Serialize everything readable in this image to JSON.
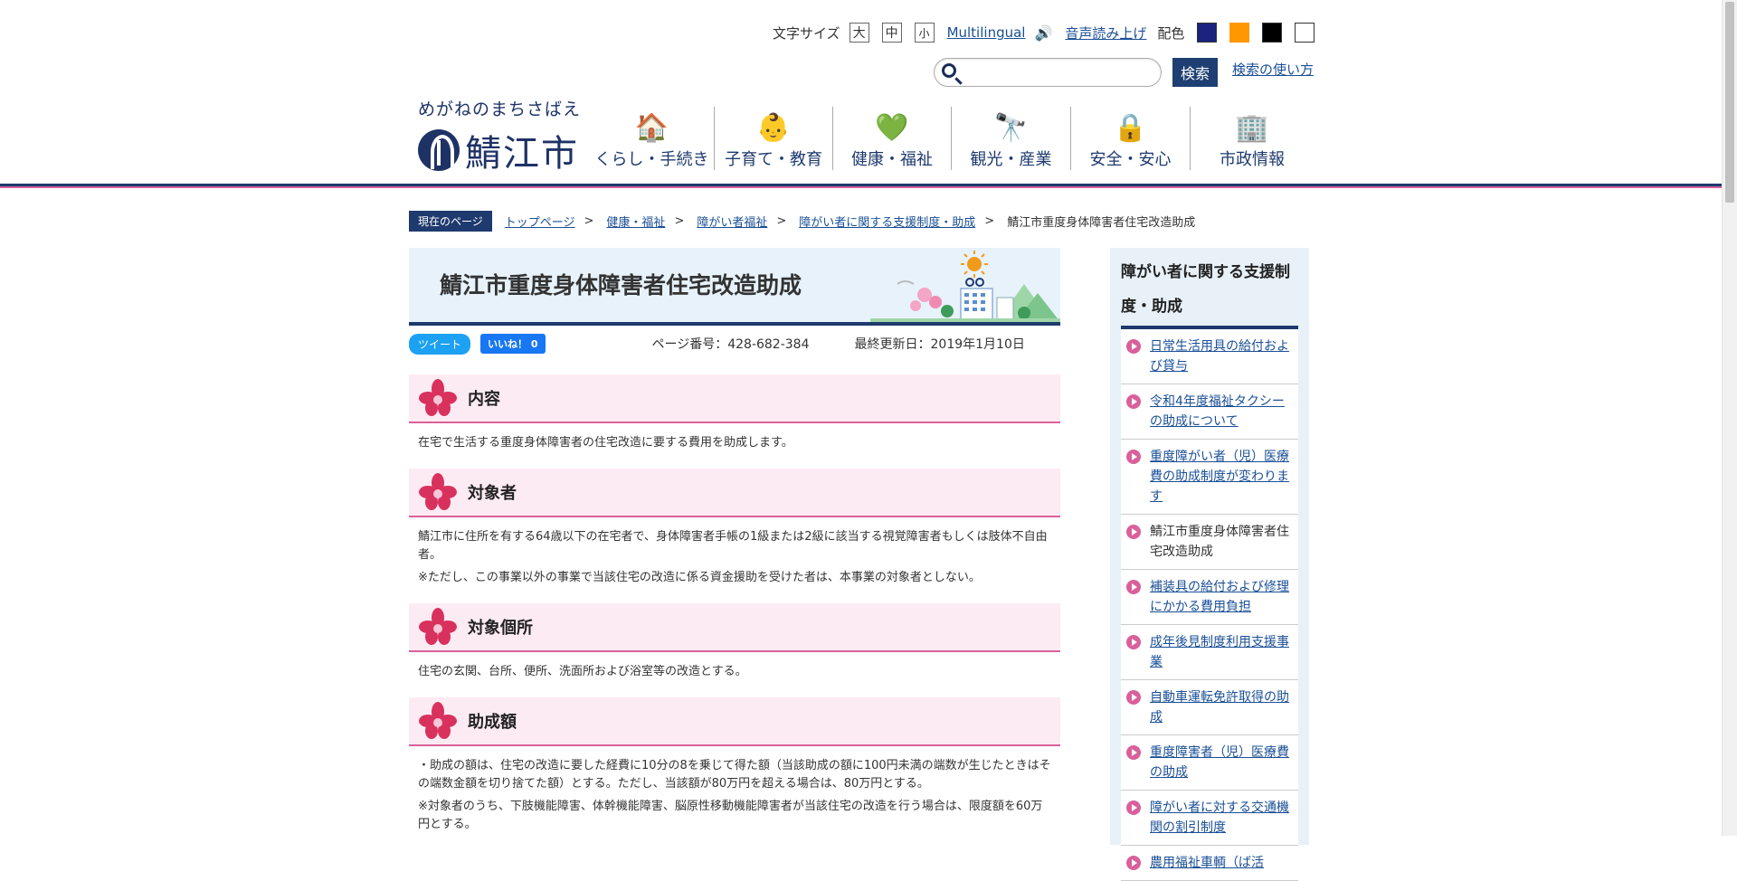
{
  "header": {
    "font_size_label": "文字サイズ",
    "font_sizes": [
      "大",
      "中",
      "小"
    ],
    "multilingual": "Multilingual",
    "read_aloud": "音声読み上げ",
    "color_label": "配色",
    "color_swatches": [
      "#1a237e",
      "#ff9800",
      "#000000",
      "#ffffff"
    ],
    "search_placeholder": "",
    "search_button": "検索",
    "search_help": "検索の使い方",
    "logo_kana": "めがねのまちさばえ",
    "logo_name": "鯖江市"
  },
  "gnav": [
    {
      "label": "くらし・手続き",
      "icon": "house-icon"
    },
    {
      "label": "子育て・教育",
      "icon": "baby-icon"
    },
    {
      "label": "健康・福祉",
      "icon": "heart-icon"
    },
    {
      "label": "観光・産業",
      "icon": "binoculars-icon"
    },
    {
      "label": "安全・安心",
      "icon": "lock-icon"
    },
    {
      "label": "市政情報",
      "icon": "building-icon"
    }
  ],
  "breadcrumb": {
    "here": "現在のページ",
    "items": [
      "トップページ",
      "健康・福祉",
      "障がい者福祉",
      "障がい者に関する支援制度・助成"
    ],
    "current": "鯖江市重度身体障害者住宅改造助成"
  },
  "main": {
    "title": "鯖江市重度身体障害者住宅改造助成",
    "tweet": "ツイート",
    "like": "いいね！ 0",
    "page_no": "ページ番号：428-682-384",
    "updated": "最終更新日：2019年1月10日",
    "sections": [
      {
        "heading": "内容",
        "paras": [
          "在宅で生活する重度身体障害者の住宅改造に要する費用を助成します。"
        ]
      },
      {
        "heading": "対象者",
        "paras": [
          "鯖江市に住所を有する64歳以下の在宅者で、身体障害者手帳の1級または2級に該当する視覚障害者もしくは肢体不自由者。",
          "※ただし、この事業以外の事業で当該住宅の改造に係る資金援助を受けた者は、本事業の対象者としない。"
        ]
      },
      {
        "heading": "対象個所",
        "paras": [
          "住宅の玄関、台所、便所、洗面所および浴室等の改造とする。"
        ]
      },
      {
        "heading": "助成額",
        "paras": [
          "・助成の額は、住宅の改造に要した経費に10分の8を乗じて得た額（当該助成の額に100円未満の端数が生じたときはその端数金額を切り捨てた額）とする。ただし、当該額が80万円を超える場合は、80万円とする。",
          "※対象者のうち、下肢機能障害、体幹機能障害、脳原性移動機能障害者が当該住宅の改造を行う場合は、限度額を60万円とする。"
        ]
      }
    ]
  },
  "side": {
    "title": "障がい者に関する支援制度・助成",
    "items": [
      {
        "label": "日常生活用具の給付および貸与",
        "link": true
      },
      {
        "label": "令和4年度福祉タクシーの助成について",
        "link": true
      },
      {
        "label": "重度障がい者（児）医療費の助成制度が変わります",
        "link": true
      },
      {
        "label": "鯖江市重度身体障害者住宅改造助成",
        "link": false
      },
      {
        "label": "補装具の給付および修理にかかる費用負担",
        "link": true
      },
      {
        "label": "成年後見制度利用支援事業",
        "link": true
      },
      {
        "label": "自動車運転免許取得の助成",
        "link": true
      },
      {
        "label": "重度障害者（児）医療費の助成",
        "link": true
      },
      {
        "label": "障がい者に対する交通機関の割引制度",
        "link": true
      },
      {
        "label": "農用福祉車輌（ば活",
        "link": true
      }
    ]
  }
}
